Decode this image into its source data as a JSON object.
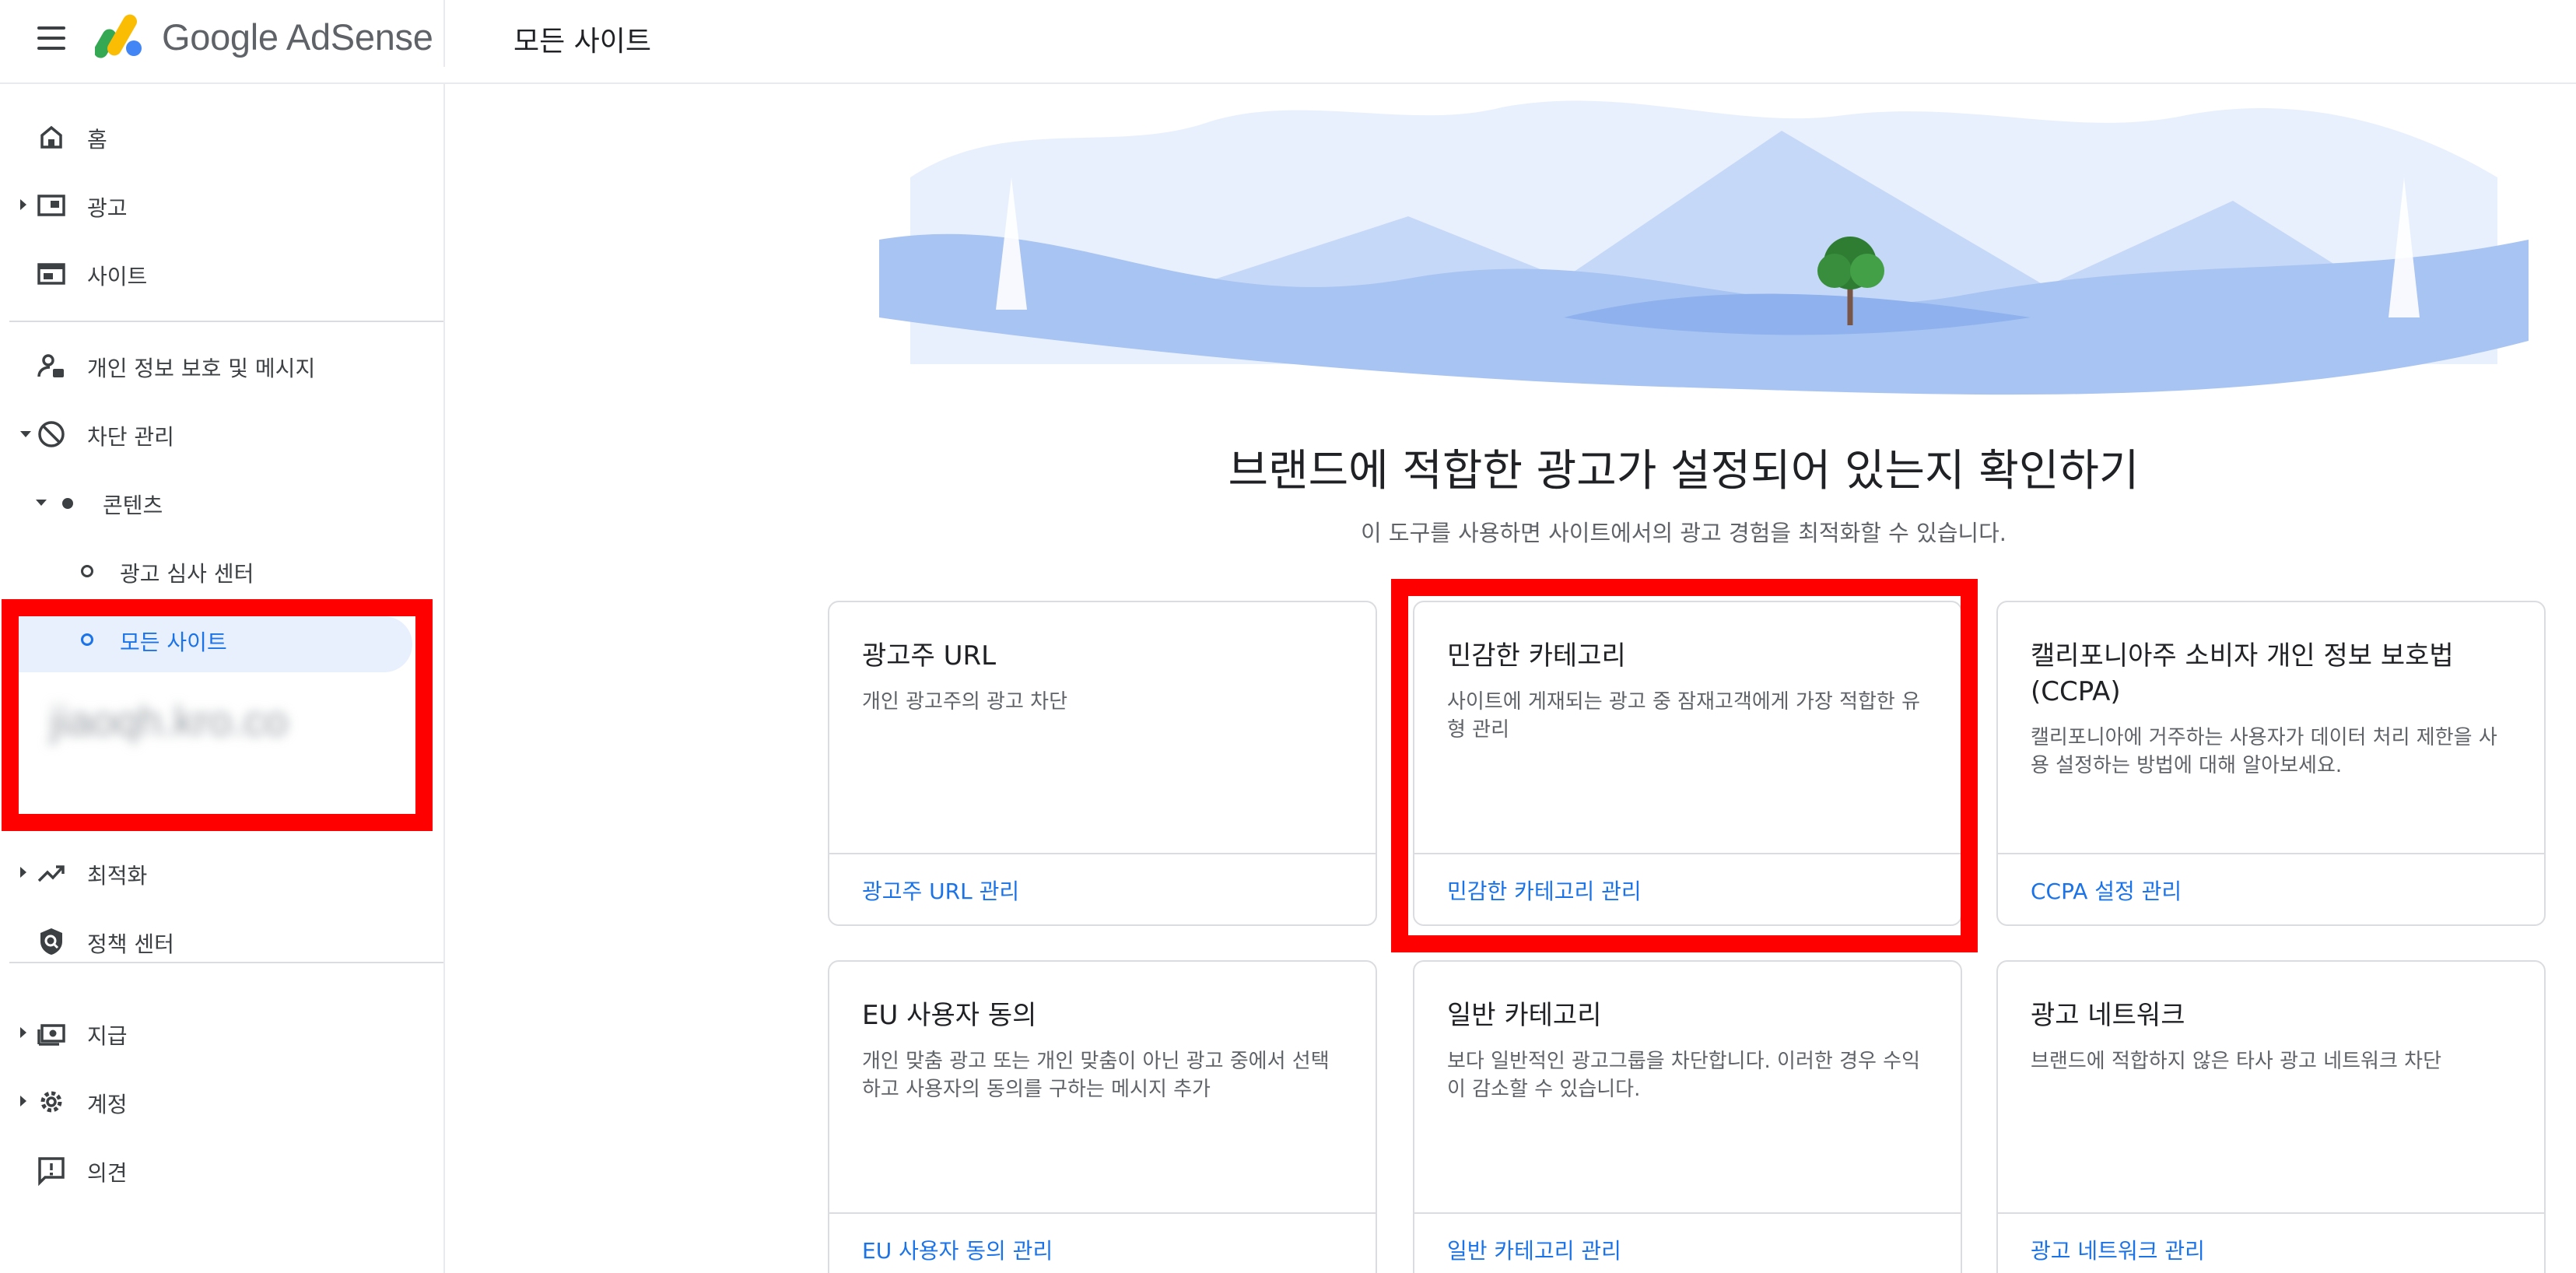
{
  "header": {
    "brand": "Google AdSense",
    "page_title": "모든 사이트"
  },
  "sidebar": {
    "items": {
      "home": "홈",
      "ads": "광고",
      "sites": "사이트",
      "privacy": "개인 정보 보호 및 메시지",
      "blocking": "차단 관리",
      "content": "콘텐츠",
      "ad_review": "광고 심사 센터",
      "all_sites": "모든 사이트",
      "site_url": "jiaoqh.kro.co",
      "optimization": "최적화",
      "policy": "정책 센터",
      "payments": "지급",
      "account": "계정",
      "feedback": "의견"
    }
  },
  "main": {
    "title": "브랜드에 적합한 광고가 설정되어 있는지 확인하기",
    "subtitle": "이 도구를 사용하면 사이트에서의 광고 경험을 최적화할 수 있습니다.",
    "cards": [
      {
        "title": "광고주 URL",
        "desc": "개인 광고주의 광고 차단",
        "link": "광고주 URL 관리"
      },
      {
        "title": "민감한 카테고리",
        "desc": "사이트에 게재되는 광고 중 잠재고객에게 가장 적합한 유형 관리",
        "link": "민감한 카테고리 관리"
      },
      {
        "title": "캘리포니아주 소비자 개인 정보 보호법 (CCPA)",
        "desc": "캘리포니아에 거주하는 사용자가 데이터 처리 제한을 사용 설정하는 방법에 대해 알아보세요.",
        "link": "CCPA 설정 관리"
      },
      {
        "title": "EU 사용자 동의",
        "desc": "개인 맞춤 광고 또는 개인 맞춤이 아닌 광고 중에서 선택하고 사용자의 동의를 구하는 메시지 추가",
        "link": "EU 사용자 동의 관리"
      },
      {
        "title": "일반 카테고리",
        "desc": "보다 일반적인 광고그룹을 차단합니다. 이러한 경우 수익이 감소할 수 있습니다.",
        "link": "일반 카테고리 관리"
      },
      {
        "title": "광고 네트워크",
        "desc": "브랜드에 적합하지 않은 타사 광고 네트워크 차단",
        "link": "광고 네트워크 관리"
      }
    ]
  },
  "colors": {
    "accent": "#1a73e8",
    "highlight": "#ff0000",
    "active_nav": "#e8f0fe"
  }
}
